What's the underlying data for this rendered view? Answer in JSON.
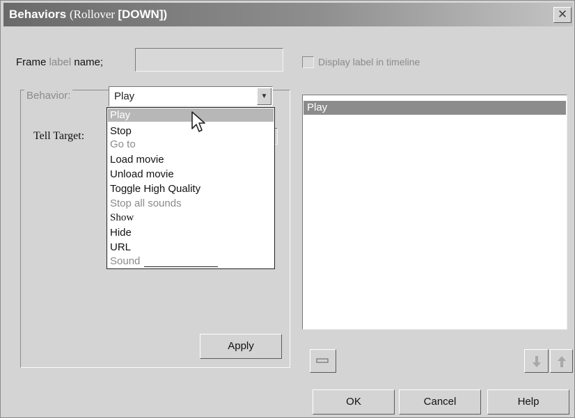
{
  "window": {
    "title_main": "Behaviors",
    "title_paren_open": "(Rollover ",
    "title_state": "[DOWN])",
    "close_glyph": "✕"
  },
  "frame_label": {
    "label_prefix": "Frame ",
    "label_highlight": "label",
    "label_suffix": " name;",
    "value": ""
  },
  "display_label": {
    "label": "Display label in timeline",
    "checked": false
  },
  "behavior": {
    "label": "Behavior:",
    "selected_value": "Play",
    "tell_target_label": "Tell Target:",
    "dropdown_options": [
      "Play",
      "Stop",
      "Go to",
      "Load movie",
      "Unload movie",
      "Toggle  High Quality",
      "Stop all sounds",
      "Show",
      "Hide",
      "URL",
      "Sound"
    ],
    "highlighted_option": "Play"
  },
  "buttons": {
    "apply": "Apply",
    "ok": "OK",
    "cancel": "Cancel",
    "help": "Help"
  },
  "actions_list": {
    "items": [
      "Play"
    ],
    "selected": "Play"
  },
  "icons": {
    "remove": "minus-icon",
    "move_down": "arrow-down-icon",
    "move_up": "arrow-up-icon",
    "dropdown_arrow": "chevron-down-icon",
    "cursor": "mouse-pointer-icon"
  }
}
